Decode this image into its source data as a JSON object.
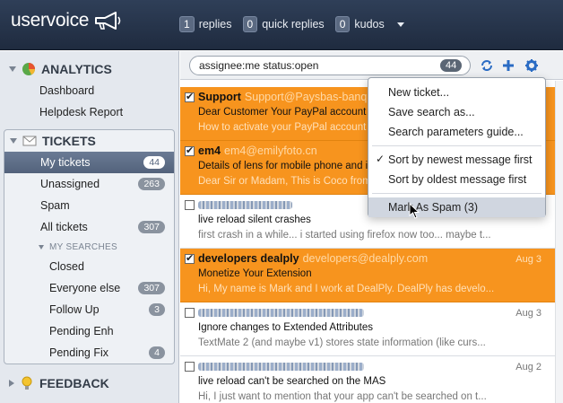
{
  "header": {
    "logo_text": "uservoice",
    "stats": [
      {
        "count": "1",
        "label": "replies"
      },
      {
        "count": "0",
        "label": "quick replies"
      },
      {
        "count": "0",
        "label": "kudos"
      }
    ]
  },
  "sidebar": {
    "analytics": {
      "title": "ANALYTICS",
      "items": [
        {
          "label": "Dashboard"
        },
        {
          "label": "Helpdesk Report"
        }
      ]
    },
    "tickets": {
      "title": "TICKETS",
      "items": [
        {
          "label": "My tickets",
          "count": "44"
        },
        {
          "label": "Unassigned",
          "count": "263"
        },
        {
          "label": "Spam"
        },
        {
          "label": "All tickets",
          "count": "307"
        }
      ],
      "my_searches_title": "MY SEARCHES",
      "searches": [
        {
          "label": "Closed"
        },
        {
          "label": "Everyone else",
          "count": "307"
        },
        {
          "label": "Follow Up",
          "count": "3"
        },
        {
          "label": "Pending Enh"
        },
        {
          "label": "Pending Fix",
          "count": "4"
        }
      ]
    },
    "feedback": {
      "title": "FEEDBACK"
    }
  },
  "search": {
    "value": "assignee:me status:open",
    "count": "44"
  },
  "tickets": [
    {
      "name": "Support",
      "email": "Support@Paysbas-banqu",
      "subject": "Dear Customer Your PayPal account Ha",
      "preview": "How to activate your PayPal account H",
      "date": "",
      "highlighted": true,
      "checked": true
    },
    {
      "name": "em4",
      "email": "em4@emilyfoto.cn",
      "subject": "Details of lens for mobile phone and iPh",
      "preview": "Dear Sir or Madam, This is Coco from",
      "date": "",
      "highlighted": true,
      "checked": true
    },
    {
      "name": "",
      "email": "",
      "subject": "live reload silent crashes",
      "preview": "first crash in a while... i started using firefox now too... maybe t...",
      "date": "",
      "highlighted": false,
      "checked": false
    },
    {
      "name": "developers dealply",
      "email": "developers@dealply.com",
      "subject": "Monetize Your Extension",
      "preview": "Hi, My name is Mark and I work at DealPly. DealPly has develo...",
      "date": "Aug 3",
      "highlighted": true,
      "checked": true
    },
    {
      "name": "",
      "email": "",
      "subject": "Ignore changes to Extended Attributes",
      "preview": "TextMate 2 (and maybe v1) stores state information (like curs...",
      "date": "Aug 3",
      "highlighted": false,
      "checked": false
    },
    {
      "name": "",
      "email": "",
      "subject": "live reload can't be searched on the MAS",
      "preview": "Hi, I just want to mention that your app can't be searched on t...",
      "date": "Aug 2",
      "highlighted": false,
      "checked": false
    }
  ],
  "dropdown": {
    "items": [
      {
        "label": "New ticket..."
      },
      {
        "label": "Save search as..."
      },
      {
        "label": "Search parameters guide..."
      },
      {
        "label": "Sort by newest message first",
        "checked": true
      },
      {
        "label": "Sort by oldest message first"
      },
      {
        "label": "Mark As Spam (3)"
      }
    ]
  },
  "colors": {
    "highlight": "#f7941e",
    "topbar": "#26344b",
    "accent": "#2b6cc4"
  }
}
